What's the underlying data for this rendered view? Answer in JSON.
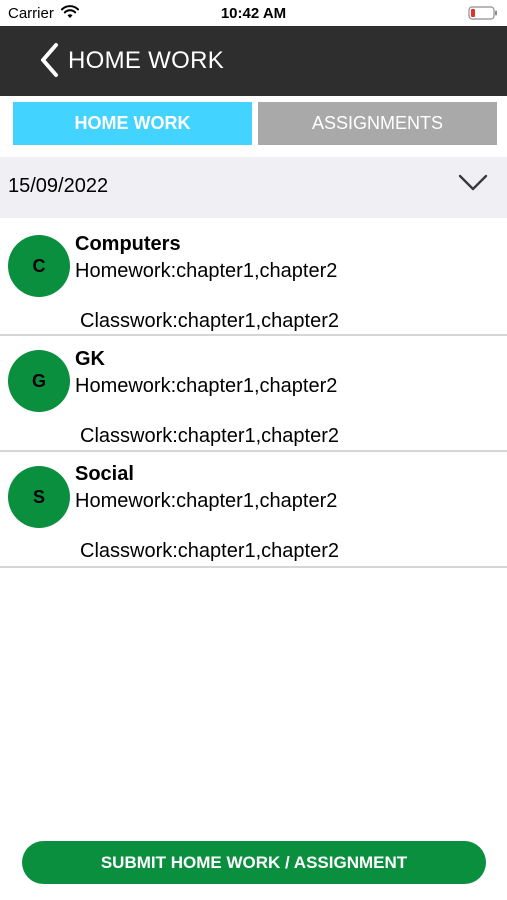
{
  "status_bar": {
    "carrier": "Carrier",
    "time": "10:42 AM",
    "wifi_icon": "wifi-icon",
    "battery_icon": "battery-low-icon",
    "battery_color": "#e0312b"
  },
  "header": {
    "back_icon": "chevron-left-icon",
    "title": "HOME WORK",
    "background": "#2e2e2e"
  },
  "tabs": [
    {
      "label": "HOME WORK",
      "active": true,
      "color": "#42d4ff"
    },
    {
      "label": "ASSIGNMENTS",
      "active": false,
      "color": "#a9a9a9"
    }
  ],
  "date_selector": {
    "value": "15/09/2022",
    "icon": "chevron-down-icon"
  },
  "subjects": [
    {
      "initial": "C",
      "name": "Computers",
      "homework": "Homework:chapter1,chapter2",
      "classwork": "Classwork:chapter1,chapter2"
    },
    {
      "initial": "G",
      "name": "GK",
      "homework": "Homework:chapter1,chapter2",
      "classwork": "Classwork:chapter1,chapter2"
    },
    {
      "initial": "S",
      "name": "Social",
      "homework": "Homework:chapter1,chapter2",
      "classwork": "Classwork:chapter1,chapter2"
    }
  ],
  "avatar_color": "#0a8f3e",
  "submit_button": {
    "label": "SUBMIT HOME WORK / ASSIGNMENT",
    "color": "#0a8f3e"
  }
}
